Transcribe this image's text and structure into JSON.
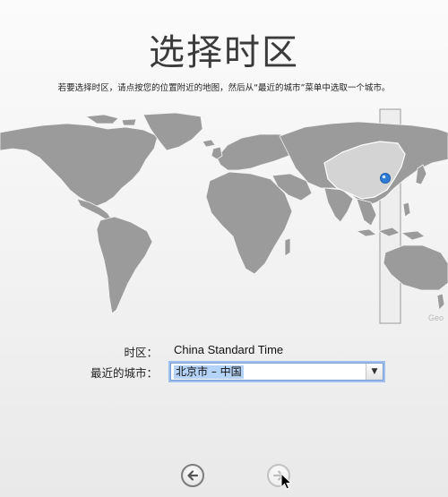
{
  "page": {
    "title": "选择时区",
    "instruction": "若要选择时区，请点按您的位置附近的地图，然后从“最近的城市”菜单中选取一个城市。"
  },
  "map": {
    "credit": "Geo",
    "selected_region": "China",
    "pin_color": "#2e7bd6",
    "band_color": "#eeeeee"
  },
  "form": {
    "timezone_label": "时区：",
    "timezone_value": "China Standard Time",
    "nearest_city_label": "最近的城市：",
    "nearest_city_value": "北京市 – 中国"
  },
  "nav": {
    "back_icon": "back-arrow-icon",
    "continue_icon": "forward-arrow-icon"
  },
  "colors": {
    "land": "#9b9b9b",
    "land_selected": "#d4d4d4",
    "focus_ring": "#9fc0ef",
    "selection": "#b5d3f7"
  }
}
